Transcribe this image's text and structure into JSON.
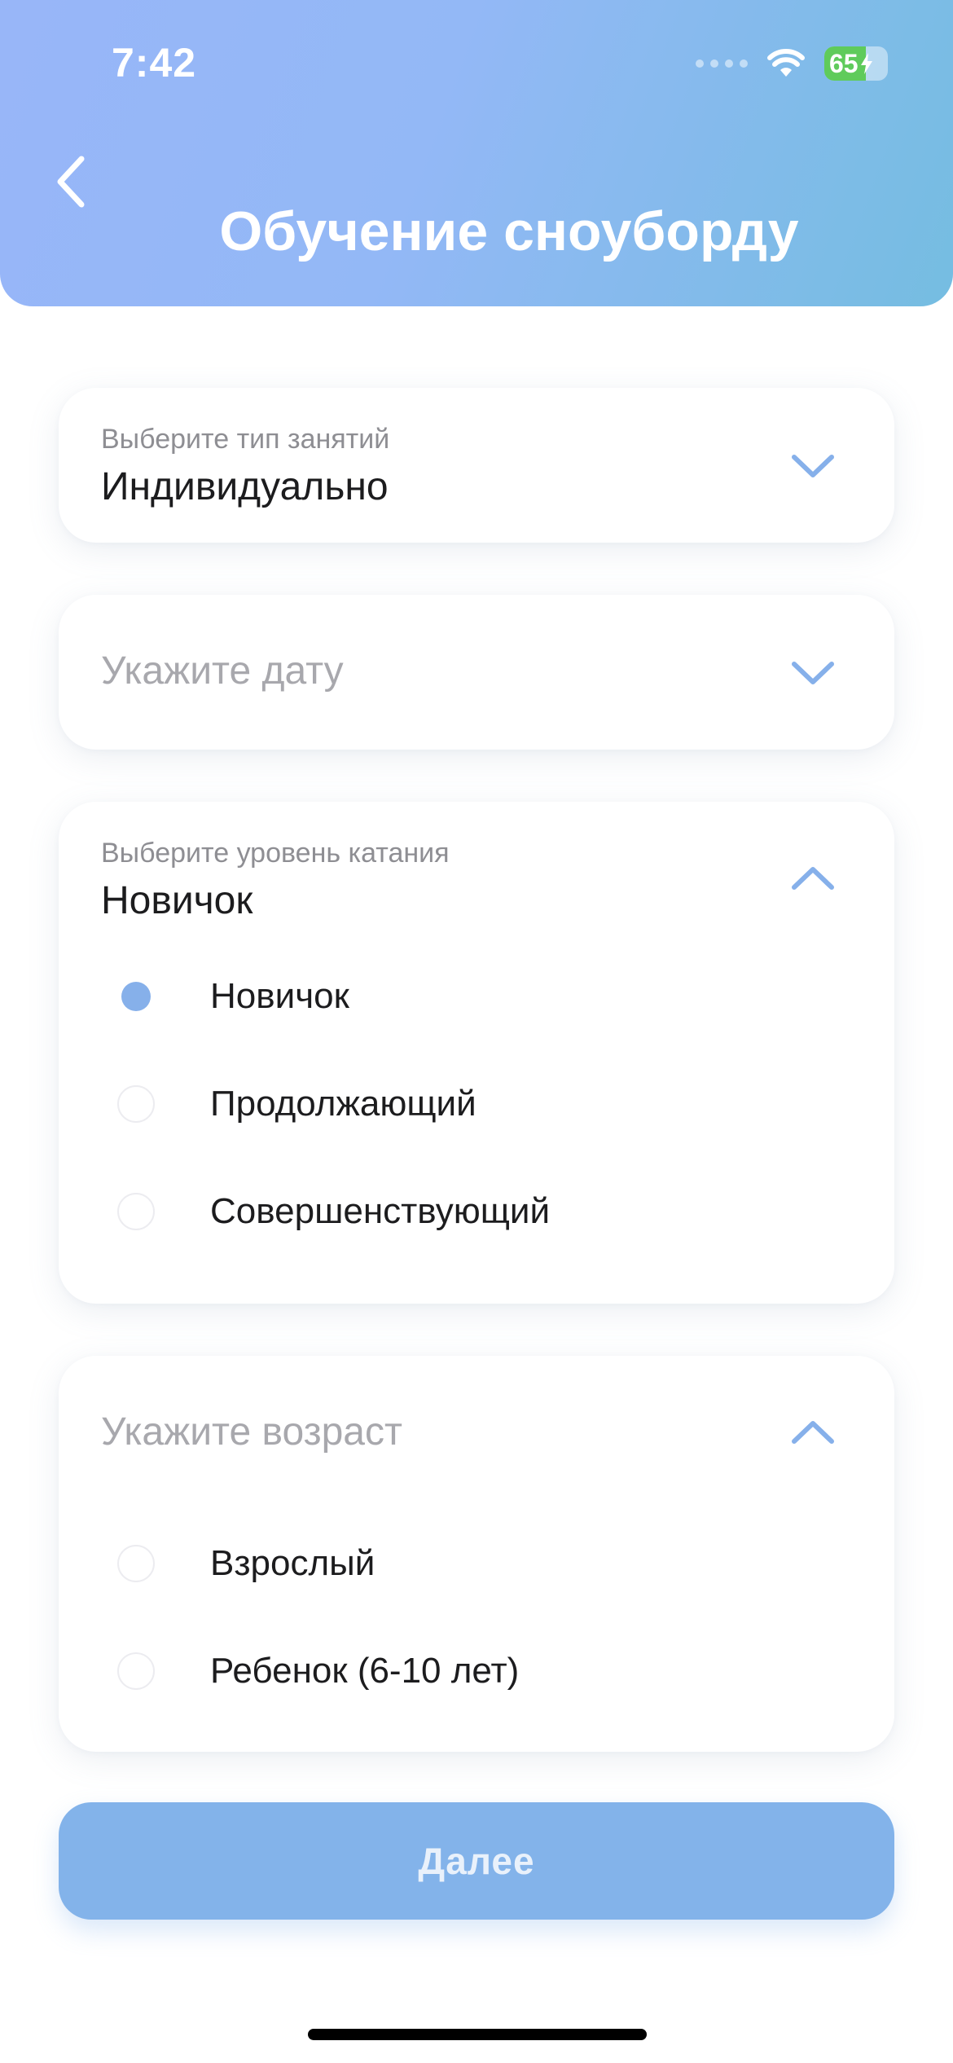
{
  "status_bar": {
    "time": "7:42",
    "battery": "65"
  },
  "header": {
    "title": "Обучение сноуборду"
  },
  "class_type": {
    "label": "Выберите тип занятий",
    "value": "Индивидуально"
  },
  "date": {
    "placeholder": "Укажите дату"
  },
  "level": {
    "label": "Выберите уровень катания",
    "value": "Новичок",
    "options": [
      {
        "label": "Новичок",
        "selected": true
      },
      {
        "label": "Продолжающий",
        "selected": false
      },
      {
        "label": "Совершенствующий",
        "selected": false
      }
    ]
  },
  "age": {
    "placeholder": "Укажите возраст",
    "options": [
      {
        "label": "Взрослый",
        "selected": false
      },
      {
        "label": "Ребенок (6-10 лет)",
        "selected": false
      }
    ]
  },
  "next_button": {
    "label": "Далее"
  },
  "colors": {
    "accent": "#83b3ea",
    "header_start": "#98b6f8",
    "header_end": "#75bde1",
    "chevron": "#86b0ea"
  }
}
